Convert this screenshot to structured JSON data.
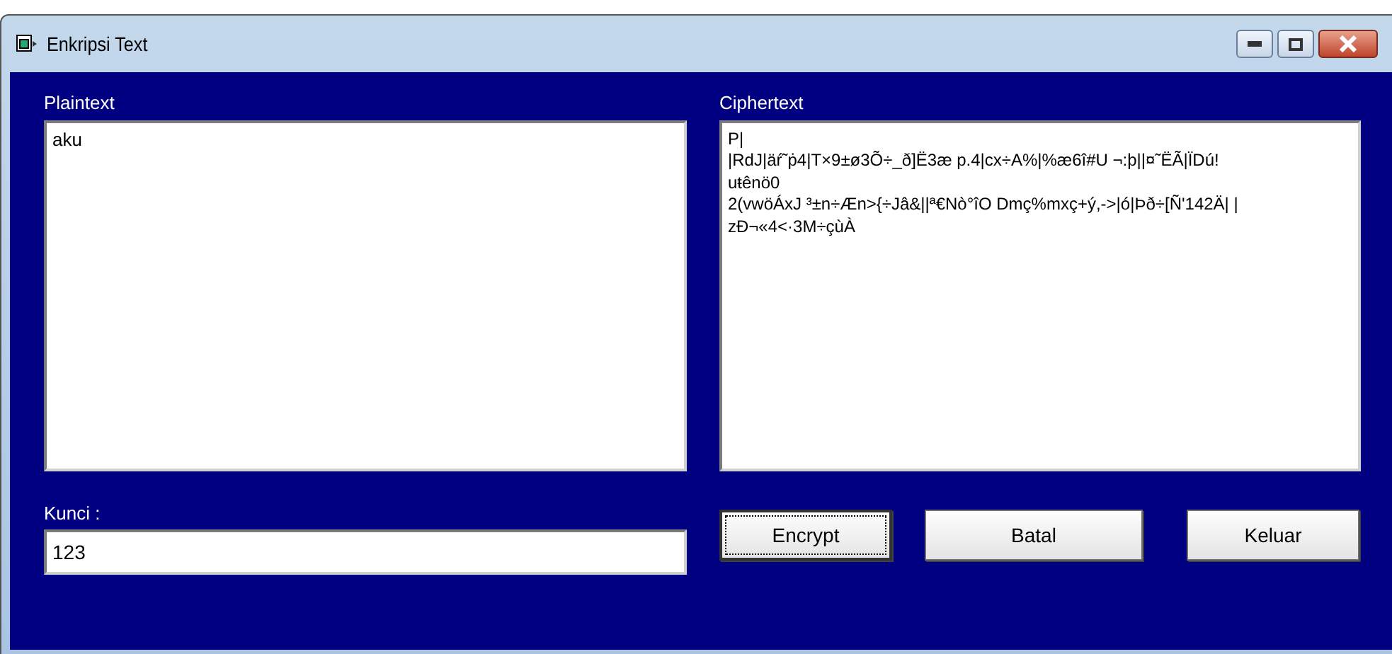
{
  "window": {
    "title": "Enkripsi Text"
  },
  "plaintext": {
    "label": "Plaintext",
    "value": "aku"
  },
  "ciphertext": {
    "label": "Ciphertext",
    "value": "P|\n|RdJ|äŕ˜ṗ4|T×9±ø3Õ÷_ð]Ë3æ p.4|cx÷A%|%æ6î#U ¬:þ||¤˜ËÃ|ÏDú!\nuŧênö0\n2(vwöÁxJ ³±n÷Æn>{÷Jâ&||ª€Nò°îO Dmç%mxç+ý,->|ó|Þð÷[Ñ'142Ä| |\nzÐ¬«4<·3M÷çùÀ"
  },
  "key": {
    "label": "Kunci :",
    "value": "123"
  },
  "buttons": [
    {
      "label": "Encrypt",
      "focused": true
    },
    {
      "label": "Batal",
      "focused": false
    },
    {
      "label": "Keluar",
      "focused": false
    }
  ]
}
